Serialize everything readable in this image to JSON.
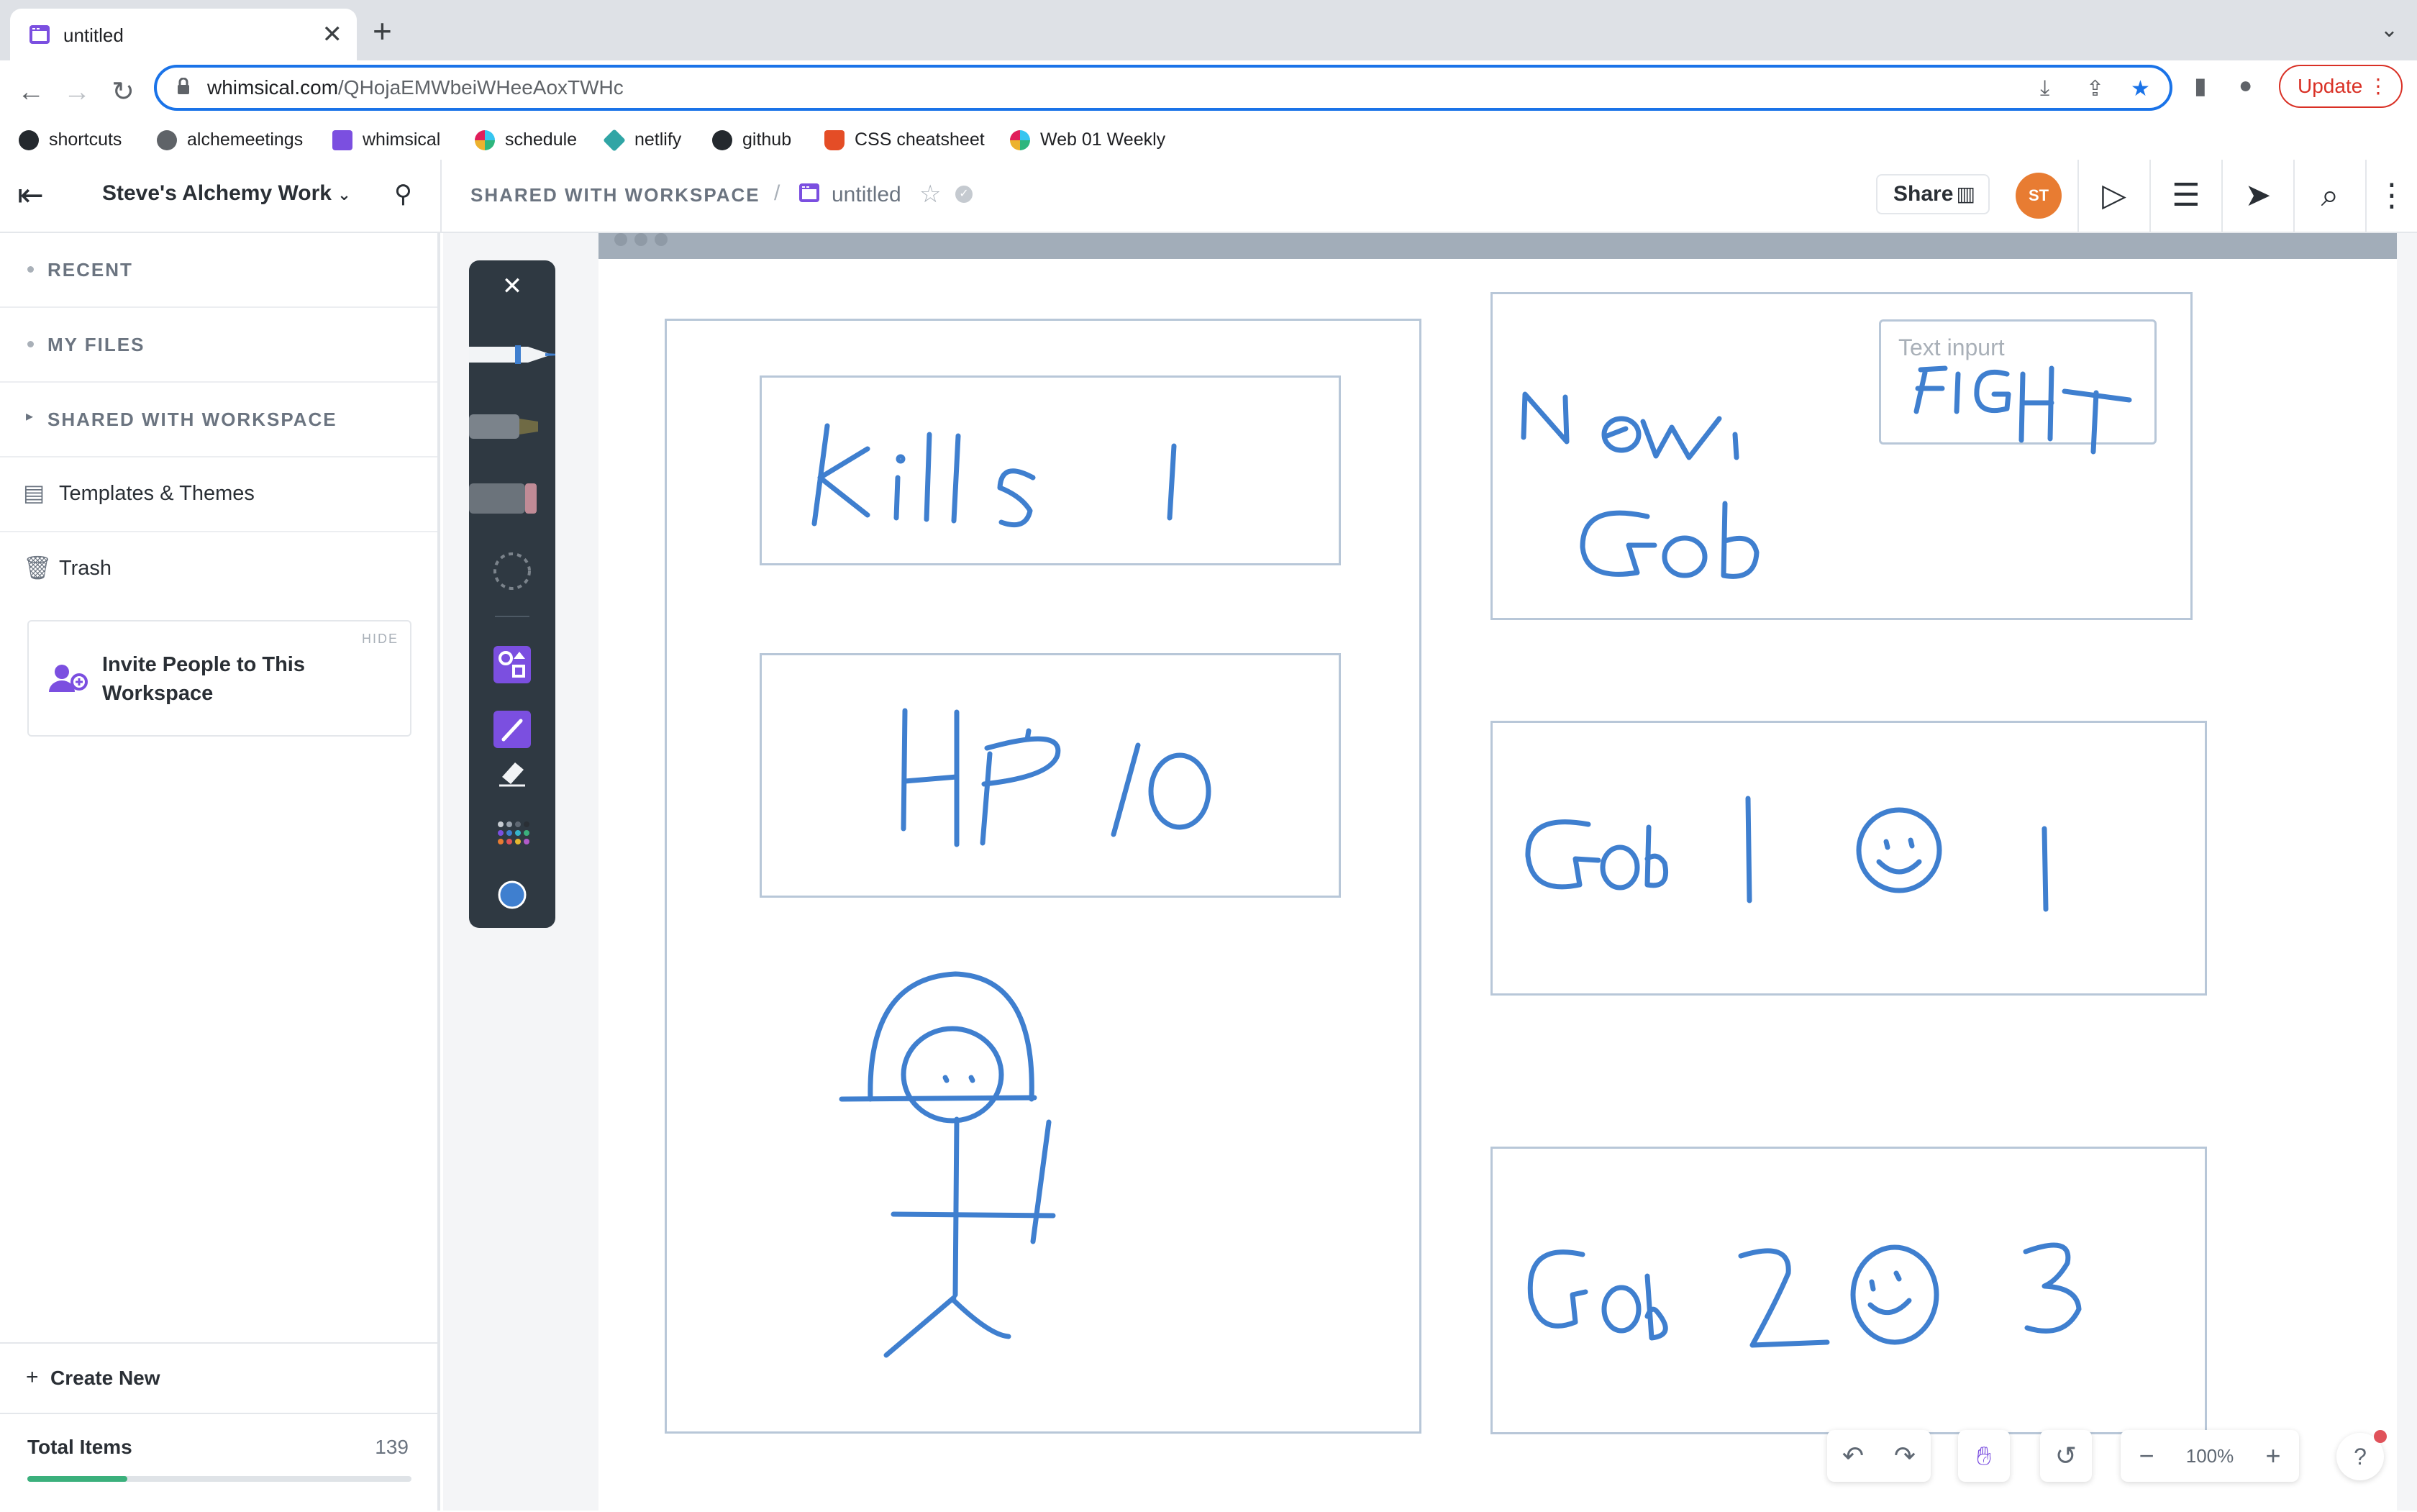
{
  "browser": {
    "tab_title": "untitled",
    "tab_close": "✕",
    "new_tab": "+",
    "url_host": "whimsical.com",
    "url_path": "/QHojaEMWbeiWHeeAoxTWHc",
    "update_label": "Update",
    "bookmarks": [
      {
        "label": "shortcuts",
        "icon": "github-icon"
      },
      {
        "label": "alchemeetings",
        "icon": "globe-icon"
      },
      {
        "label": "whimsical",
        "icon": "whimsical-icon"
      },
      {
        "label": "schedule",
        "icon": "slack-icon"
      },
      {
        "label": "netlify",
        "icon": "netlify-icon"
      },
      {
        "label": "github",
        "icon": "github-icon"
      },
      {
        "label": "CSS cheatsheet",
        "icon": "html5-icon"
      },
      {
        "label": "Web 01 Weekly",
        "icon": "slack-icon"
      }
    ]
  },
  "header": {
    "workspace_name": "Steve's Alchemy Work",
    "breadcrumb_shared": "SHARED WITH WORKSPACE",
    "breadcrumb_sep": "/",
    "file_name": "untitled",
    "share_label": "Share",
    "avatar_initials": "ST"
  },
  "sidebar": {
    "items": [
      {
        "label": "RECENT",
        "kind": "section"
      },
      {
        "label": "MY FILES",
        "kind": "section"
      },
      {
        "label": "SHARED WITH WORKSPACE",
        "kind": "section"
      },
      {
        "label": "Templates & Themes",
        "kind": "link"
      },
      {
        "label": "Trash",
        "kind": "link"
      }
    ],
    "invite": {
      "hide_label": "HIDE",
      "text": "Invite People to This Workspace"
    },
    "create_new": "Create New",
    "total_items_label": "Total Items",
    "total_items_count": "139",
    "usage_fraction": 0.26
  },
  "canvas": {
    "text_input_placeholder": "Text inpurt",
    "handwriting": [
      "kills 1",
      "HP 10",
      "New Gob",
      "FIGHT",
      "Gob 1 ☺ 1",
      "Gob 2 ☺ 3"
    ]
  },
  "pen_toolbar": {
    "close": "✕",
    "active_color": "#3f7fcf"
  },
  "bottom": {
    "zoom": "100%",
    "help": "?"
  },
  "colors": {
    "accent": "#7b4fe0",
    "ink": "#3f7fcf",
    "avatar": "#e87c32",
    "update": "#d93025",
    "progress": "#3bb07c"
  }
}
